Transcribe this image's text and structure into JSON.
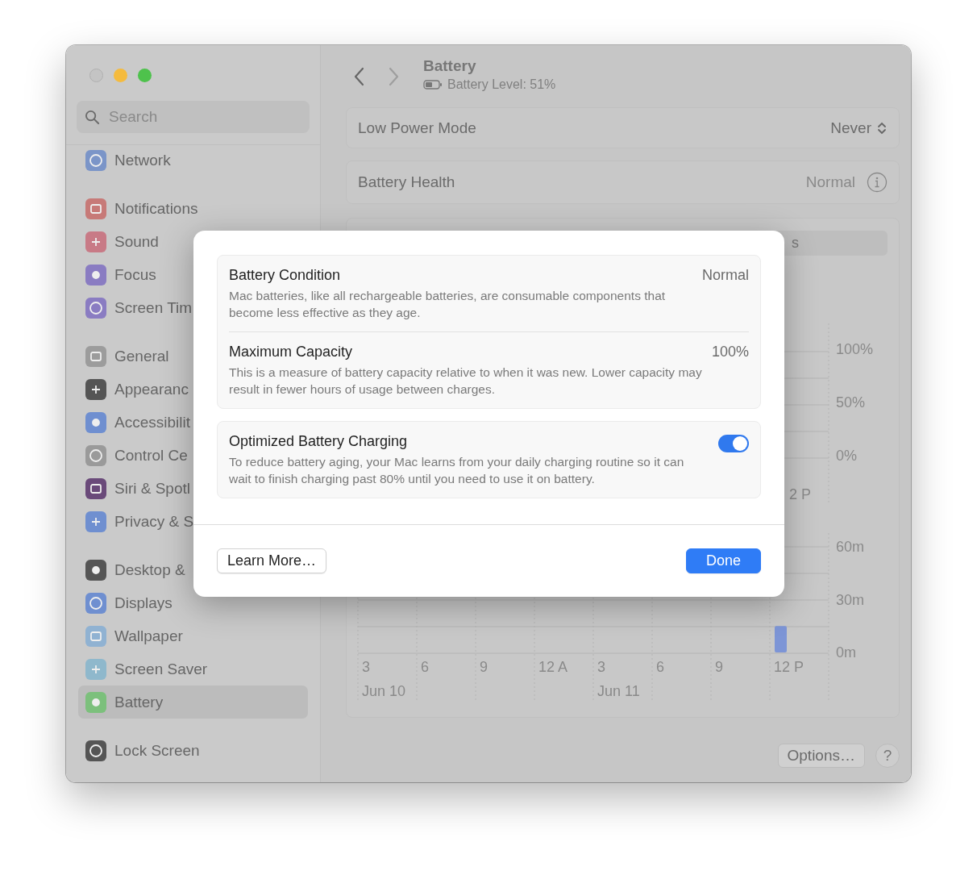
{
  "sidebar": {
    "search": {
      "placeholder": "Search"
    },
    "groups": [
      [
        {
          "label": "Network",
          "color": "#7b95c8",
          "selected": false
        }
      ],
      [
        {
          "label": "Notifications",
          "color": "#c77a78",
          "selected": false
        },
        {
          "label": "Sound",
          "color": "#c87a86",
          "selected": false
        },
        {
          "label": "Focus",
          "color": "#8a7cc2",
          "selected": false
        },
        {
          "label": "Screen Tim",
          "color": "#8a7cc2",
          "selected": false
        }
      ],
      [
        {
          "label": "General",
          "color": "#9c9c9c",
          "selected": false
        },
        {
          "label": "Appearanc",
          "color": "#555555",
          "selected": false
        },
        {
          "label": "Accessibilit",
          "color": "#6f8fd0",
          "selected": false
        },
        {
          "label": "Control Ce",
          "color": "#9a9a9a",
          "selected": false
        },
        {
          "label": "Siri & Spotl",
          "color": "#6a4a7a",
          "selected": false
        },
        {
          "label": "Privacy & S",
          "color": "#6f8fd0",
          "selected": false
        }
      ],
      [
        {
          "label": "Desktop &",
          "color": "#555555",
          "selected": false
        },
        {
          "label": "Displays",
          "color": "#6f8fd0",
          "selected": false
        },
        {
          "label": "Wallpaper",
          "color": "#90b2d2",
          "selected": false
        },
        {
          "label": "Screen Saver",
          "color": "#8fb8cc",
          "selected": false
        },
        {
          "label": "Battery",
          "color": "#7cc07c",
          "selected": true
        }
      ],
      [
        {
          "label": "Lock Screen",
          "color": "#555555",
          "selected": false
        }
      ]
    ]
  },
  "header": {
    "title": "Battery",
    "subtitle": "Battery Level: 51%",
    "back": {
      "disabled": false
    },
    "forward": {
      "disabled": true
    }
  },
  "settings": [
    {
      "kind": "popup",
      "label": "Low Power Mode",
      "value": "Never"
    },
    {
      "kind": "info",
      "label": "Battery Health",
      "value": "Normal"
    }
  ],
  "usage": {
    "segment_text": "s",
    "level_chart": {
      "y_labels": [
        "100%",
        "50%",
        "0%"
      ],
      "x_label": "2 P"
    },
    "dates": [
      "Jun 10",
      "Jun 11"
    ],
    "chart_data": {
      "type": "bar",
      "categories": [
        "3",
        "6",
        "9",
        "12 A",
        "3",
        "6",
        "9",
        "12 P"
      ],
      "series": [
        {
          "color": "#7d95d6",
          "values": [
            0,
            0,
            0,
            0,
            0,
            0,
            0,
            15
          ]
        }
      ],
      "ylim": [
        0,
        60
      ],
      "yticks": [
        {
          "value": 60,
          "label": "60m"
        },
        {
          "value": 30,
          "label": "30m"
        },
        {
          "value": 0,
          "label": "0m"
        }
      ]
    }
  },
  "footer": {
    "options": "Options…",
    "help": "?"
  },
  "dialog": {
    "groups": [
      {
        "rows": [
          {
            "kind": "value",
            "title": "Battery Condition",
            "value": "Normal",
            "description": "Mac batteries, like all rechargeable batteries, are consumable components that become less effective as they age."
          },
          {
            "kind": "value",
            "title": "Maximum Capacity",
            "value": "100%",
            "description": "This is a measure of battery capacity relative to when it was new. Lower capacity may result in fewer hours of usage between charges."
          }
        ]
      },
      {
        "rows": [
          {
            "kind": "toggle",
            "title": "Optimized Battery Charging",
            "on": true,
            "description": "To reduce battery aging, your Mac learns from your daily charging routine so it can wait to finish charging past 80% until you need to use it on battery."
          }
        ]
      }
    ],
    "buttons": [
      {
        "label": "Learn More…",
        "default": false
      },
      {
        "label": "Done",
        "default": true
      }
    ]
  }
}
